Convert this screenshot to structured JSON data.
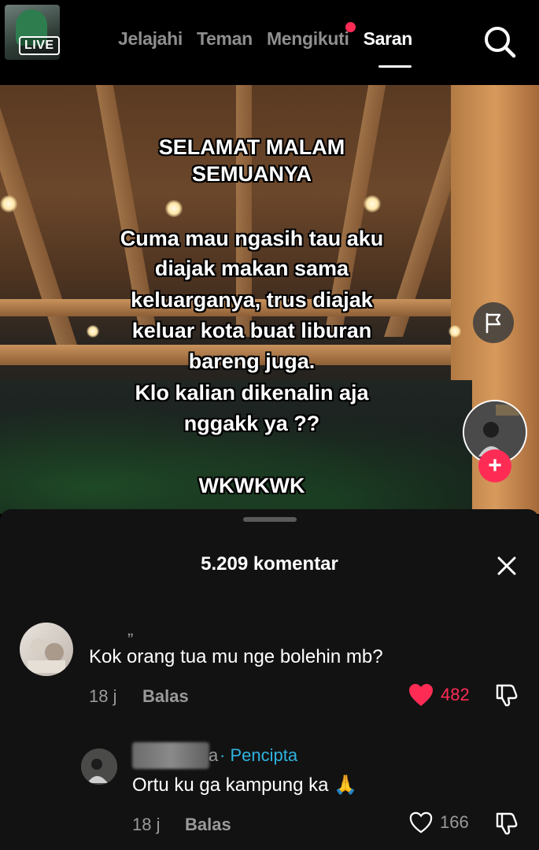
{
  "header": {
    "live_label": "LIVE",
    "tabs": [
      {
        "label": "Jelajahi",
        "active": false
      },
      {
        "label": "Teman",
        "active": false
      },
      {
        "label": "Mengikuti",
        "active": false,
        "has_dot": true
      },
      {
        "label": "Saran",
        "active": true
      }
    ],
    "search_icon": "search-icon"
  },
  "video": {
    "overlay_lines": [
      "SELAMAT MALAM",
      "SEMUANYA",
      "",
      "Cuma mau ngasih tau aku",
      "diajak makan sama",
      "keluarganya, trus diajak",
      "keluar kota buat liburan",
      "bareng juga.",
      "Klo kalian dikenalin aja",
      "nggakk ya ??",
      "",
      "WKWKWK"
    ],
    "flag_icon": "flag-icon",
    "follow_icon": "plus-icon"
  },
  "comments_sheet": {
    "title": "5.209 komentar",
    "close_icon": "close-icon",
    "comments": [
      {
        "username": "„",
        "text": "Kok orang tua mu nge bolehin mb?",
        "time": "18 j",
        "reply_label": "Balas",
        "likes": "482",
        "liked": true
      },
      {
        "username_suffix": "a",
        "creator_tag": "· Pencipta",
        "text": "Ortu ku ga kampung ka 🙏",
        "time": "18 j",
        "reply_label": "Balas",
        "likes": "166",
        "liked": false
      }
    ]
  },
  "colors": {
    "accent": "#fe2c55",
    "creator_tag": "#2fb3e0",
    "sheet_bg": "#121212"
  }
}
